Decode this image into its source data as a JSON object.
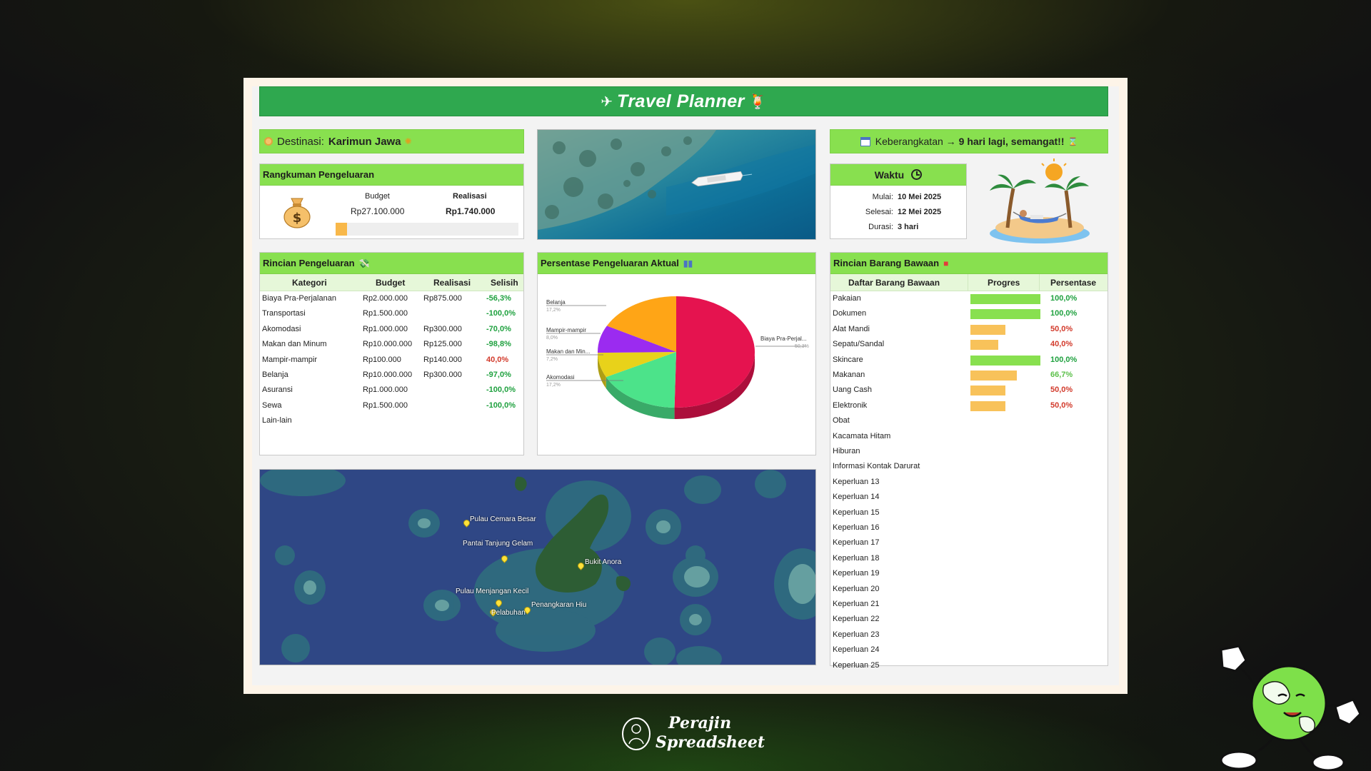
{
  "app": {
    "title": "Travel Planner"
  },
  "destination": {
    "label": "Destinasi:",
    "value": "Karimun Jawa"
  },
  "departure": {
    "label": "Keberangkatan →",
    "value": "9 hari lagi, semangat!!"
  },
  "summary": {
    "title": "Rangkuman Pengeluaran",
    "budget_label": "Budget",
    "budget_value": "Rp27.100.000",
    "actual_label": "Realisasi",
    "actual_value": "Rp1.740.000",
    "progress_fraction": 0.064
  },
  "time": {
    "title": "Waktu",
    "rows": [
      {
        "label": "Mulai:",
        "value": "10 Mei 2025"
      },
      {
        "label": "Selesai:",
        "value": "12 Mei 2025"
      },
      {
        "label": "Durasi:",
        "value": "3 hari"
      }
    ]
  },
  "expenses": {
    "title": "Rincian Pengeluaran",
    "columns": [
      "Kategori",
      "Budget",
      "Realisasi",
      "Selisih"
    ],
    "rows": [
      {
        "category": "Biaya Pra-Perjalanan",
        "budget": "Rp2.000.000",
        "actual": "Rp875.000",
        "diff": "-56,3%",
        "tone": "pos"
      },
      {
        "category": "Transportasi",
        "budget": "Rp1.500.000",
        "actual": "",
        "diff": "-100,0%",
        "tone": "pos"
      },
      {
        "category": "Akomodasi",
        "budget": "Rp1.000.000",
        "actual": "Rp300.000",
        "diff": "-70,0%",
        "tone": "pos"
      },
      {
        "category": "Makan dan Minum",
        "budget": "Rp10.000.000",
        "actual": "Rp125.000",
        "diff": "-98,8%",
        "tone": "pos"
      },
      {
        "category": "Mampir-mampir",
        "budget": "Rp100.000",
        "actual": "Rp140.000",
        "diff": "40,0%",
        "tone": "neg"
      },
      {
        "category": "Belanja",
        "budget": "Rp10.000.000",
        "actual": "Rp300.000",
        "diff": "-97,0%",
        "tone": "pos"
      },
      {
        "category": "Asuransi",
        "budget": "Rp1.000.000",
        "actual": "",
        "diff": "-100,0%",
        "tone": "pos"
      },
      {
        "category": "Sewa",
        "budget": "Rp1.500.000",
        "actual": "",
        "diff": "-100,0%",
        "tone": "pos"
      },
      {
        "category": "Lain-lain",
        "budget": "",
        "actual": "",
        "diff": "",
        "tone": "pos"
      }
    ]
  },
  "chart_panel": {
    "title": "Persentase Pengeluaran Aktual"
  },
  "chart_data": {
    "type": "pie",
    "categories": [
      "Biaya Pra-Perjal...",
      "Akomodasi",
      "Makan dan Min...",
      "Mampir-mampir",
      "Belanja"
    ],
    "values": [
      50.3,
      17.2,
      7.2,
      8.0,
      17.2
    ],
    "value_labels": [
      "50,3%",
      "17,2%",
      "7,2%",
      "8,0%",
      "17,2%"
    ],
    "colors": [
      "#e5134f",
      "#4ce38a",
      "#e8d21a",
      "#9b2bf0",
      "#ffa516"
    ],
    "legend": "none"
  },
  "map": {
    "pins": [
      {
        "label": "Pulau Cemara Besar"
      },
      {
        "label": "Pantai Tanjung Gelam"
      },
      {
        "label": "Bukit Anora"
      },
      {
        "label": "Pulau Menjangan Kecil"
      },
      {
        "label": "Penangkaran Hiu"
      },
      {
        "label": "Pelabuhan"
      }
    ]
  },
  "items": {
    "title": "Rincian Barang Bawaan",
    "columns": [
      "Daftar Barang Bawaan",
      "Progres",
      "Persentase"
    ],
    "rows": [
      {
        "name": "Pakaian",
        "progress": 1.0,
        "pct": "100,0%",
        "tone": "pos"
      },
      {
        "name": "Dokumen",
        "progress": 1.0,
        "pct": "100,0%",
        "tone": "pos"
      },
      {
        "name": "Alat Mandi",
        "progress": 0.5,
        "pct": "50,0%",
        "tone": "neg"
      },
      {
        "name": "Sepatu/Sandal",
        "progress": 0.4,
        "pct": "40,0%",
        "tone": "neg"
      },
      {
        "name": "Skincare",
        "progress": 1.0,
        "pct": "100,0%",
        "tone": "pos"
      },
      {
        "name": "Makanan",
        "progress": 0.667,
        "pct": "66,7%",
        "tone": "mid"
      },
      {
        "name": "Uang Cash",
        "progress": 0.5,
        "pct": "50,0%",
        "tone": "neg"
      },
      {
        "name": "Elektronik",
        "progress": 0.5,
        "pct": "50,0%",
        "tone": "neg"
      },
      {
        "name": "Obat",
        "progress": 0,
        "pct": "",
        "tone": "pos"
      },
      {
        "name": "Kacamata Hitam",
        "progress": 0,
        "pct": "",
        "tone": "pos"
      },
      {
        "name": "Hiburan",
        "progress": 0,
        "pct": "",
        "tone": "pos"
      },
      {
        "name": "Informasi Kontak Darurat",
        "progress": 0,
        "pct": "",
        "tone": "pos"
      },
      {
        "name": "Keperluan 13",
        "progress": 0,
        "pct": "",
        "tone": "pos"
      },
      {
        "name": "Keperluan 14",
        "progress": 0,
        "pct": "",
        "tone": "pos"
      },
      {
        "name": "Keperluan 15",
        "progress": 0,
        "pct": "",
        "tone": "pos"
      },
      {
        "name": "Keperluan 16",
        "progress": 0,
        "pct": "",
        "tone": "pos"
      },
      {
        "name": "Keperluan 17",
        "progress": 0,
        "pct": "",
        "tone": "pos"
      },
      {
        "name": "Keperluan 18",
        "progress": 0,
        "pct": "",
        "tone": "pos"
      },
      {
        "name": "Keperluan 19",
        "progress": 0,
        "pct": "",
        "tone": "pos"
      },
      {
        "name": "Keperluan 20",
        "progress": 0,
        "pct": "",
        "tone": "pos"
      },
      {
        "name": "Keperluan 21",
        "progress": 0,
        "pct": "",
        "tone": "pos"
      },
      {
        "name": "Keperluan 22",
        "progress": 0,
        "pct": "",
        "tone": "pos"
      },
      {
        "name": "Keperluan 23",
        "progress": 0,
        "pct": "",
        "tone": "pos"
      },
      {
        "name": "Keperluan 24",
        "progress": 0,
        "pct": "",
        "tone": "pos"
      },
      {
        "name": "Keperluan 25",
        "progress": 0,
        "pct": "",
        "tone": "pos"
      }
    ]
  },
  "brand": {
    "line1": "Perajin",
    "line2": "Spreadsheet"
  },
  "colors": {
    "title_green": "#2fa84f",
    "header_green": "#88e04f",
    "bar_full": "#88e04f",
    "bar_partial": "#f8c25a",
    "positive": "#1fa13f",
    "negative": "#d23a2b"
  }
}
